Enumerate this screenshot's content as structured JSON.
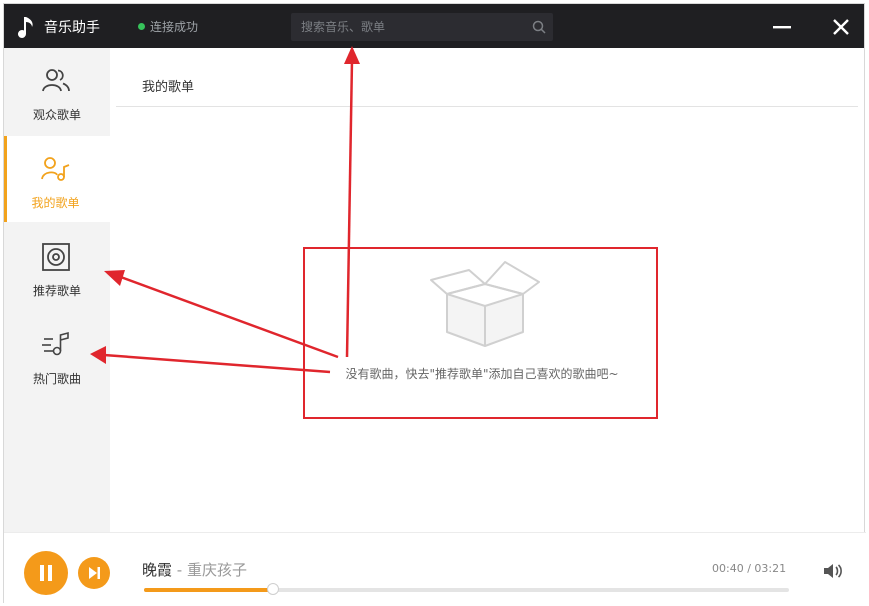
{
  "app": {
    "title": "音乐助手"
  },
  "status": {
    "text": "连接成功",
    "color": "#36c25a"
  },
  "search": {
    "placeholder": "搜索音乐、歌单",
    "value": ""
  },
  "window_controls": {
    "minimize_icon": "minimize-icon",
    "close_icon": "close-icon"
  },
  "sidebar": {
    "items": [
      {
        "label": "观众歌单",
        "icon": "audience-icon",
        "active": false
      },
      {
        "label": "我的歌单",
        "icon": "user-music-icon",
        "active": true
      },
      {
        "label": "推荐歌单",
        "icon": "speaker-icon",
        "active": false
      },
      {
        "label": "热门歌曲",
        "icon": "hot-music-icon",
        "active": false
      }
    ]
  },
  "main": {
    "title": "我的歌单",
    "empty_icon": "empty-box-icon",
    "empty_text": "没有歌曲，快去\"推荐歌单\"添加自己喜欢的歌曲吧~"
  },
  "player": {
    "song_title": "晚霞",
    "separator": "-",
    "artist": "重庆孩子",
    "time": "00:40 / 03:21",
    "progress": 0.2,
    "accent_color": "#f49a1a"
  },
  "annotation_color": "#e0262d"
}
